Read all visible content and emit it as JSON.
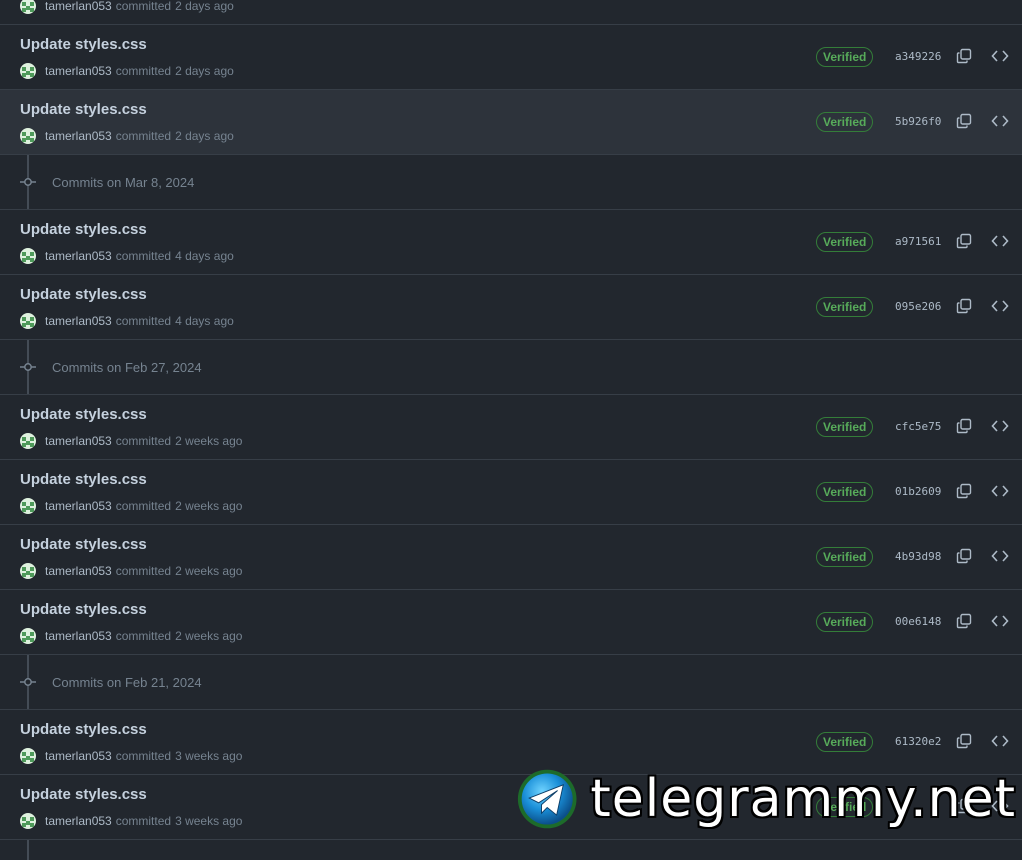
{
  "verified_label": "Verified",
  "commits": [
    {
      "title": "",
      "author": "tamerlan053",
      "action": "committed",
      "time": "2 days ago",
      "sha": "",
      "hovered": false,
      "partial": true
    },
    {
      "title": "Update styles.css",
      "author": "tamerlan053",
      "action": "committed",
      "time": "2 days ago",
      "sha": "a349226",
      "hovered": false
    },
    {
      "title": "Update styles.css",
      "author": "tamerlan053",
      "action": "committed",
      "time": "2 days ago",
      "sha": "5b926f0",
      "hovered": true
    },
    {
      "group": "Commits on Mar 8, 2024"
    },
    {
      "title": "Update styles.css",
      "author": "tamerlan053",
      "action": "committed",
      "time": "4 days ago",
      "sha": "a971561",
      "hovered": false
    },
    {
      "title": "Update styles.css",
      "author": "tamerlan053",
      "action": "committed",
      "time": "4 days ago",
      "sha": "095e206",
      "hovered": false
    },
    {
      "group": "Commits on Feb 27, 2024"
    },
    {
      "title": "Update styles.css",
      "author": "tamerlan053",
      "action": "committed",
      "time": "2 weeks ago",
      "sha": "cfc5e75",
      "hovered": false
    },
    {
      "title": "Update styles.css",
      "author": "tamerlan053",
      "action": "committed",
      "time": "2 weeks ago",
      "sha": "01b2609",
      "hovered": false
    },
    {
      "title": "Update styles.css",
      "author": "tamerlan053",
      "action": "committed",
      "time": "2 weeks ago",
      "sha": "4b93d98",
      "hovered": false
    },
    {
      "title": "Update styles.css",
      "author": "tamerlan053",
      "action": "committed",
      "time": "2 weeks ago",
      "sha": "00e6148",
      "hovered": false
    },
    {
      "group": "Commits on Feb 21, 2024"
    },
    {
      "title": "Update styles.css",
      "author": "tamerlan053",
      "action": "committed",
      "time": "3 weeks ago",
      "sha": "61320e2",
      "hovered": false
    },
    {
      "title": "Update styles.css",
      "author": "tamerlan053",
      "action": "committed",
      "time": "3 weeks ago",
      "sha": "",
      "hovered": false
    }
  ],
  "watermark": {
    "text": "telegrammy.net"
  },
  "icons": {
    "copy": "copy-icon",
    "browse": "code-icon",
    "commit": "git-commit-icon",
    "verified": "verified-badge"
  },
  "colors": {
    "background": "#22272e",
    "hover_row": "#2d333b",
    "verified": "#57ab5a",
    "border": "#373e47"
  }
}
